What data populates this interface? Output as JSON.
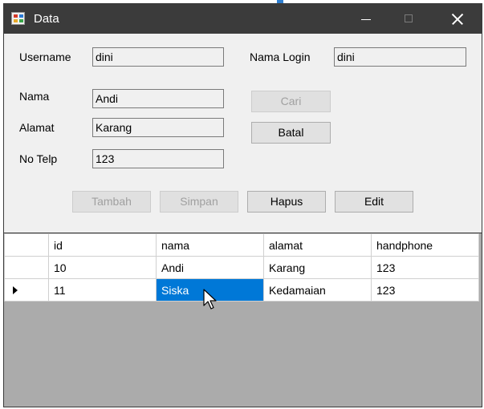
{
  "window": {
    "title": "Data",
    "minimize_icon": "minimize-icon",
    "maximize_icon": "maximize-icon",
    "close_icon": "close-icon"
  },
  "form": {
    "username": {
      "label": "Username",
      "value": "dini"
    },
    "nama_login": {
      "label": "Nama Login",
      "value": "dini"
    },
    "nama": {
      "label": "Nama",
      "value": "Andi"
    },
    "alamat": {
      "label": "Alamat",
      "value": "Karang"
    },
    "no_telp": {
      "label": "No Telp",
      "value": "123"
    }
  },
  "buttons": {
    "cari": "Cari",
    "batal": "Batal",
    "tambah": "Tambah",
    "simpan": "Simpan",
    "hapus": "Hapus",
    "edit": "Edit"
  },
  "grid": {
    "columns": [
      "id",
      "nama",
      "alamat",
      "handphone"
    ],
    "rows": [
      {
        "id": "10",
        "nama": "Andi",
        "alamat": "Karang",
        "handphone": "123"
      },
      {
        "id": "11",
        "nama": "Siska",
        "alamat": "Kedamaian",
        "handphone": "123"
      }
    ],
    "selection_color": "#0078d7"
  }
}
